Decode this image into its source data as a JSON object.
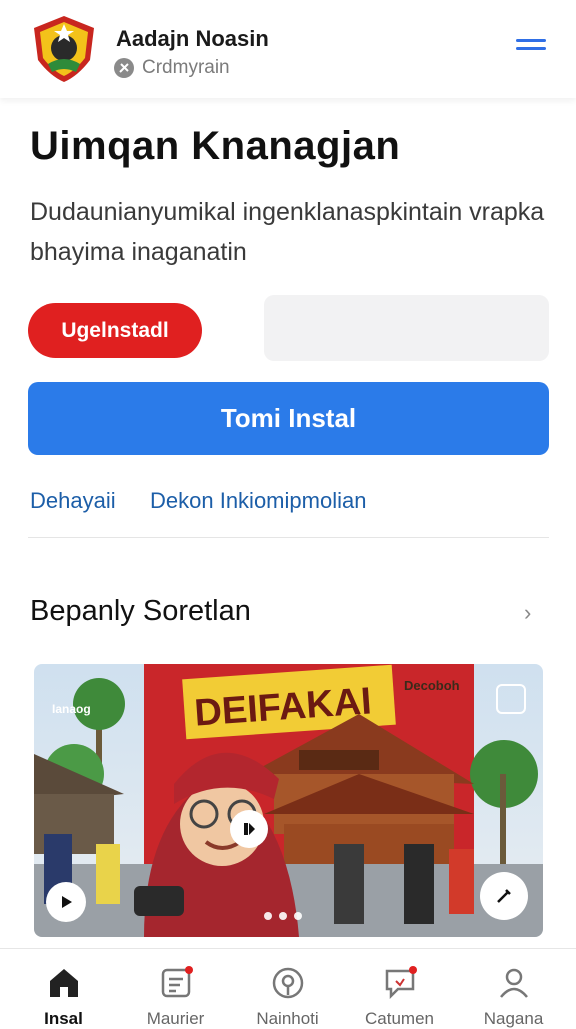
{
  "header": {
    "brand_name": "Aadajn Noasin",
    "brand_sub": "Crdmyrain",
    "logo_icon": "emblem-logo",
    "menu_icon": "hamburger-menu-icon"
  },
  "hero": {
    "title": "Uimqan Knanagjan",
    "description": "Dudaunianyumikal ingenklanaspkintain vrapka bhayima inaganatin"
  },
  "actions": {
    "uninstall_label": "Ugelnstadl",
    "install_label": "Tomi Instal",
    "link_1": "Dehayaii",
    "link_2": "Dekon Inkiomipmolian"
  },
  "section": {
    "title": "Bepanly Soretlan",
    "chevron": "›"
  },
  "media": {
    "banner_text": "DEIFAKAI",
    "tag_left": "Ianaog",
    "tag_right": "Decoboh",
    "carousel_dots": 3
  },
  "bottom_nav": {
    "items": [
      {
        "label": "Insal",
        "icon": "home-icon",
        "active": true
      },
      {
        "label": "Maurier",
        "icon": "document-icon",
        "active": false
      },
      {
        "label": "Nainhoti",
        "icon": "location-pin-icon",
        "active": false
      },
      {
        "label": "Catumen",
        "icon": "chat-icon",
        "active": false
      },
      {
        "label": "Nagana",
        "icon": "user-icon",
        "active": false
      }
    ]
  },
  "colors": {
    "accent_blue": "#2b7be9",
    "danger_red": "#e02020",
    "link_blue": "#1c5ea8"
  }
}
